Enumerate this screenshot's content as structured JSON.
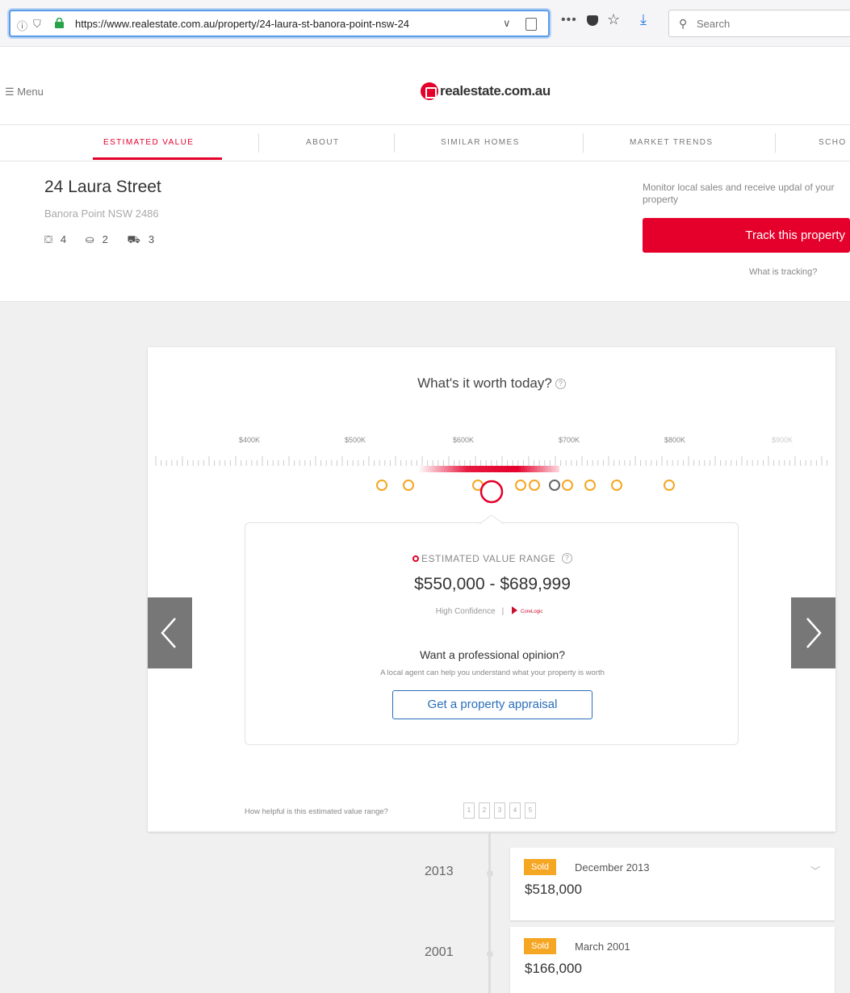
{
  "browser": {
    "url": "https://www.realestate.com.au/property/24-laura-st-banora-point-nsw-24",
    "search_placeholder": "Search"
  },
  "header": {
    "menu_label": "Menu",
    "logo_text": "realestate.com.au"
  },
  "tabs": [
    {
      "label": "ESTIMATED VALUE",
      "active": true
    },
    {
      "label": "ABOUT"
    },
    {
      "label": "SIMILAR HOMES"
    },
    {
      "label": "MARKET TRENDS"
    },
    {
      "label": "SCHO"
    }
  ],
  "property": {
    "address": "24 Laura Street",
    "suburb": "Banora Point NSW 2486",
    "beds": "4",
    "baths": "2",
    "cars": "3"
  },
  "tracking": {
    "monitor_text": "Monitor local sales and receive updal of your property",
    "track_button": "Track this property",
    "what_is_tracking": "What is tracking?"
  },
  "estimate": {
    "title": "What's it worth today?",
    "scale_labels": [
      "$400K",
      "$500K",
      "$600K",
      "$700K",
      "$800K",
      "$900K"
    ],
    "range_label": "ESTIMATED VALUE RANGE",
    "range_value": "$550,000 - $689,999",
    "confidence": "High Confidence",
    "provider": "CoreLogic",
    "opinion_title": "Want a professional opinion?",
    "opinion_sub": "A local agent can help you understand what your property is worth",
    "appraisal_button": "Get a property appraisal",
    "helpful_question": "How helpful is this estimated value range?",
    "ratings": [
      "1",
      "2",
      "3",
      "4",
      "5"
    ]
  },
  "history": [
    {
      "year": "2013",
      "badge": "Sold",
      "date": "December 2013",
      "price": "$518,000"
    },
    {
      "year": "2001",
      "badge": "Sold",
      "date": "March 2001",
      "price": "$166,000"
    }
  ],
  "colors": {
    "brand": "#e4002b",
    "sold_badge": "#f5a623",
    "link": "#2a6ebb"
  }
}
